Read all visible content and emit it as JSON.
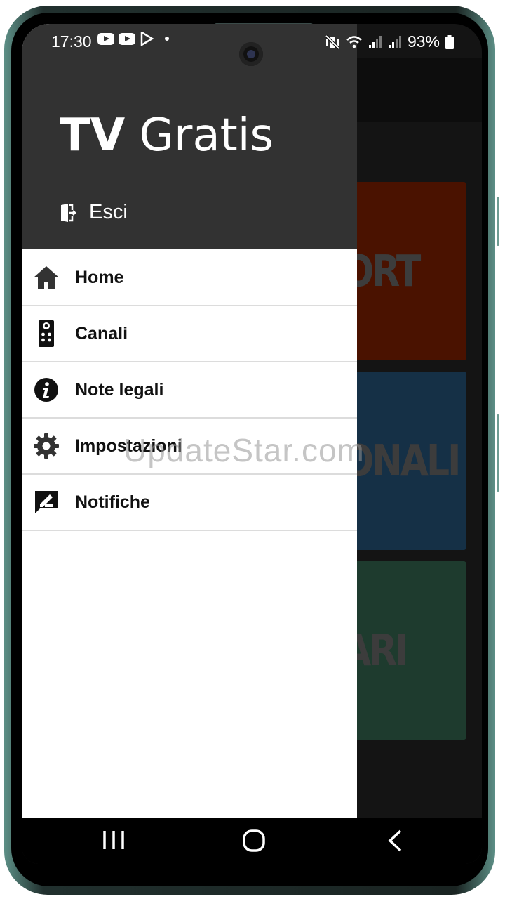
{
  "status_bar": {
    "time": "17:30",
    "battery": "93%"
  },
  "background_app": {
    "tiles": [
      "ORT",
      "ONALI",
      "ARI"
    ],
    "tile_colors": [
      "#6b1a00",
      "#1f4565",
      "#2b5542"
    ]
  },
  "drawer": {
    "title_bold": "TV",
    "title_rest": " Gratis",
    "exit_label": "Esci",
    "items": [
      {
        "label": "Home",
        "icon": "home-icon"
      },
      {
        "label": "Canali",
        "icon": "remote-control-icon"
      },
      {
        "label": "Note legali",
        "icon": "info-icon"
      },
      {
        "label": "Impostazioni",
        "icon": "gear-icon"
      },
      {
        "label": "Notifiche",
        "icon": "feedback-icon"
      }
    ],
    "header_color": "#323232"
  },
  "watermark": "UpdateStar.com"
}
